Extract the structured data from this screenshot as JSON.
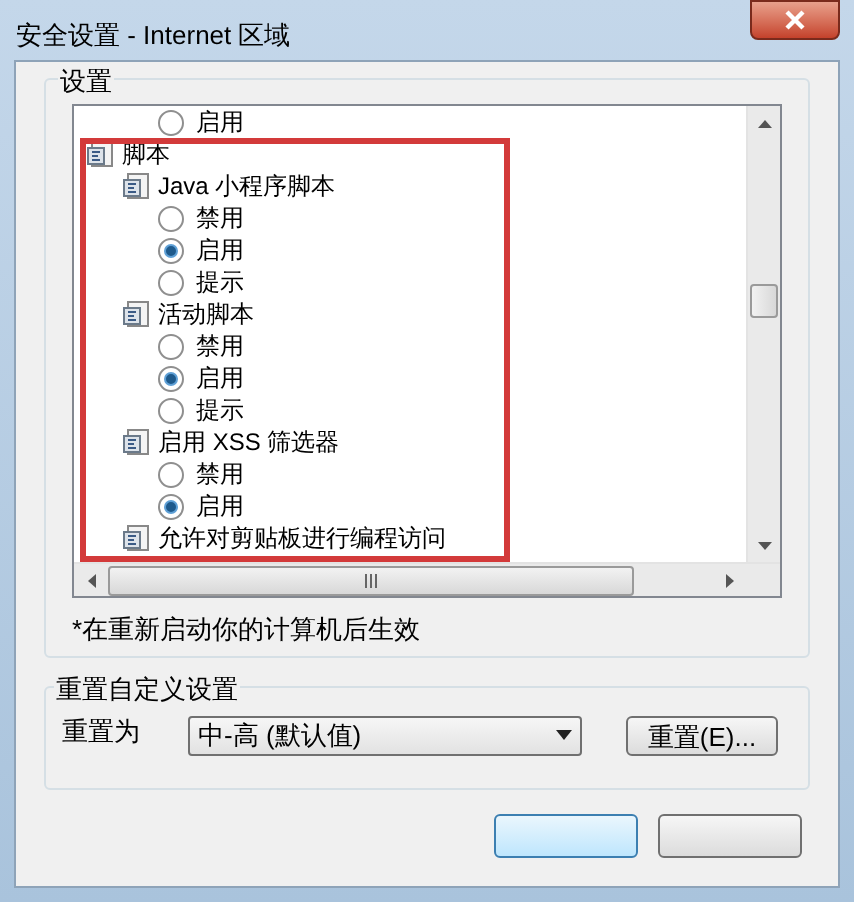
{
  "window": {
    "title": "安全设置 - Internet 区域"
  },
  "settings": {
    "label": "设置",
    "tree": {
      "partial_top": [
        {
          "kind": "radio",
          "label": "启用",
          "selected": false
        }
      ],
      "nodes": [
        {
          "kind": "group",
          "label": "脚本",
          "children": [
            {
              "kind": "group",
              "label": "Java 小程序脚本",
              "children": [
                {
                  "kind": "radio",
                  "label": "禁用",
                  "selected": false
                },
                {
                  "kind": "radio",
                  "label": "启用",
                  "selected": true
                },
                {
                  "kind": "radio",
                  "label": "提示",
                  "selected": false
                }
              ]
            },
            {
              "kind": "group",
              "label": "活动脚本",
              "children": [
                {
                  "kind": "radio",
                  "label": "禁用",
                  "selected": false
                },
                {
                  "kind": "radio",
                  "label": "启用",
                  "selected": true
                },
                {
                  "kind": "radio",
                  "label": "提示",
                  "selected": false
                }
              ]
            },
            {
              "kind": "group",
              "label": "启用 XSS 筛选器",
              "children": [
                {
                  "kind": "radio",
                  "label": "禁用",
                  "selected": false
                },
                {
                  "kind": "radio",
                  "label": "启用",
                  "selected": true
                }
              ]
            },
            {
              "kind": "group",
              "label": "允许对剪贴板进行编程访问"
            }
          ]
        }
      ]
    },
    "note": "*在重新启动你的计算机后生效"
  },
  "reset": {
    "label": "重置自定义设置",
    "field_label": "重置为",
    "value": "中-高 (默认值)",
    "button": "重置(E)..."
  }
}
